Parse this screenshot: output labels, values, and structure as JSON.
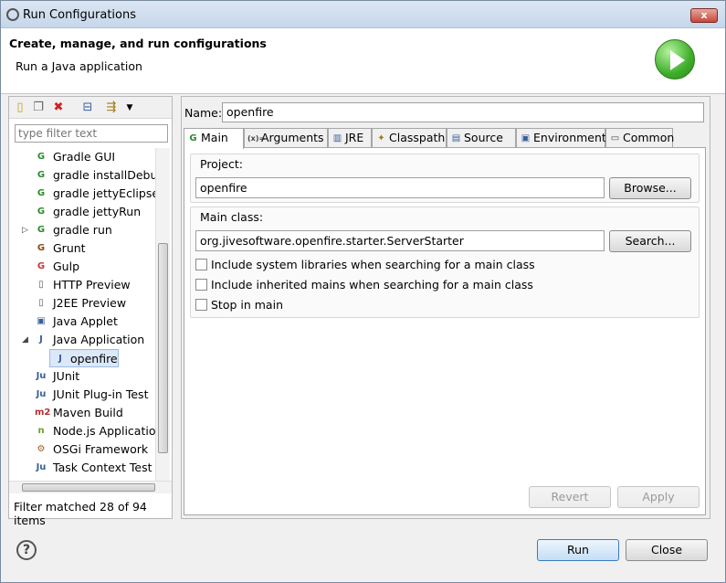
{
  "window": {
    "title": "Run Configurations",
    "close_label": "x"
  },
  "header": {
    "title": "Create, manage, and run configurations",
    "subtitle": "Run a Java application"
  },
  "left": {
    "filter_placeholder": "type filter text",
    "tree": [
      {
        "label": "Gradle GUI",
        "icon": "G",
        "color": "#2b8a2b"
      },
      {
        "label": "gradle installDebug",
        "icon": "G",
        "color": "#2b8a2b"
      },
      {
        "label": "gradle jettyEclipseRun",
        "icon": "G",
        "color": "#2b8a2b"
      },
      {
        "label": "gradle jettyRun",
        "icon": "G",
        "color": "#2b8a2b"
      },
      {
        "label": "gradle run",
        "icon": "G",
        "color": "#2b8a2b",
        "expand": "▷"
      },
      {
        "label": "Grunt",
        "icon": "G",
        "color": "#8a4a10"
      },
      {
        "label": "Gulp",
        "icon": "G",
        "color": "#cc3333"
      },
      {
        "label": "HTTP Preview",
        "icon": "▯",
        "color": "#555555"
      },
      {
        "label": "J2EE Preview",
        "icon": "▯",
        "color": "#555555"
      },
      {
        "label": "Java Applet",
        "icon": "▣",
        "color": "#3a5f9a"
      },
      {
        "label": "Java Application",
        "icon": "J",
        "color": "#3a5f9a",
        "expand": "◢"
      },
      {
        "label": "openfire",
        "icon": "J",
        "color": "#3a5f9a",
        "child": true,
        "selected": true
      },
      {
        "label": "JUnit",
        "icon": "Ju",
        "color": "#3a5f9a"
      },
      {
        "label": "JUnit Plug-in Test",
        "icon": "Ju",
        "color": "#3a5f9a"
      },
      {
        "label": "Maven Build",
        "icon": "m2",
        "color": "#b03030"
      },
      {
        "label": "Node.js Application",
        "icon": "n",
        "color": "#6b9e2f"
      },
      {
        "label": "OSGi Framework",
        "icon": "⚙",
        "color": "#a05a20"
      },
      {
        "label": "Task Context Test",
        "icon": "Ju",
        "color": "#3a5f9a"
      }
    ],
    "filter_status": "Filter matched 28 of 94 items"
  },
  "right": {
    "name_label": "Name:",
    "name_value": "openfire",
    "tabs": [
      {
        "label": "Main",
        "icon": "G",
        "color": "#2b8a2b",
        "active": true
      },
      {
        "label": "Arguments",
        "icon": "(x)=",
        "color": "#444444"
      },
      {
        "label": "JRE",
        "icon": "▥",
        "color": "#3a5f9a"
      },
      {
        "label": "Classpath",
        "icon": "✦",
        "color": "#a07a10"
      },
      {
        "label": "Source",
        "icon": "▤",
        "color": "#3a5f9a"
      },
      {
        "label": "Environment",
        "icon": "▣",
        "color": "#3a5f9a"
      },
      {
        "label": "Common",
        "icon": "▭",
        "color": "#444444"
      }
    ],
    "project_label": "Project:",
    "project_value": "openfire",
    "browse_label": "Browse...",
    "main_class_label": "Main class:",
    "main_class_value": "org.jivesoftware.openfire.starter.ServerStarter",
    "search_label": "Search...",
    "checks": [
      {
        "label": "Include system libraries when searching for a main class"
      },
      {
        "label": "Include inherited mains when searching for a main class"
      },
      {
        "label": "Stop in main"
      }
    ],
    "revert_label": "Revert",
    "apply_label": "Apply"
  },
  "footer": {
    "help_label": "?",
    "run_label": "Run",
    "close_label": "Close"
  }
}
